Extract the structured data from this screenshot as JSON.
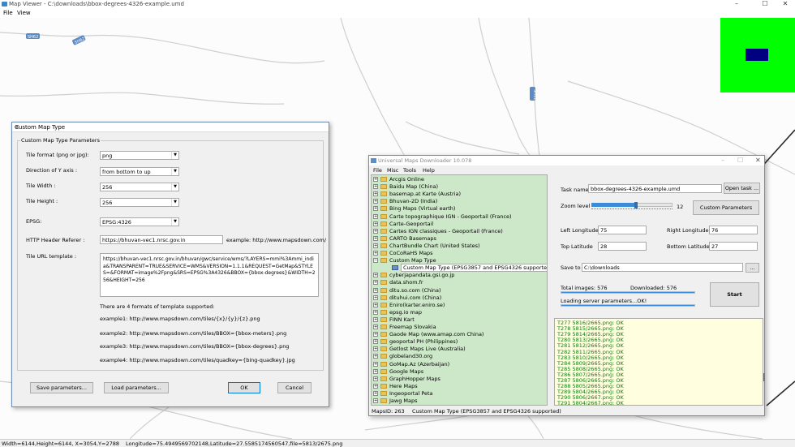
{
  "window": {
    "title": "Map Viewer - C:\\downloads\\bbox-degrees-4326-example.umd",
    "controls": [
      "–",
      "☐",
      "✕"
    ]
  },
  "menubar": {
    "items": [
      "File",
      "View"
    ]
  },
  "map": {
    "road_labels": [
      "SH62",
      "SH62",
      "SH12"
    ]
  },
  "statusbar": {
    "size": "Width=6144,Height=6144, X=3054,Y=2788",
    "coords": "Longitude=75.4949569702148,Latitude=27.5585174560547,file=5813/2675.png"
  },
  "dialog": {
    "title": "Custom Map Type",
    "close": "✕",
    "group_label": "Custom Map Type Parameters",
    "tile_format_label": "Tile format (png or jpg):",
    "tile_format_value": "png",
    "y_axis_label": "Direction of Y axis :",
    "y_axis_value": "from bottom to up",
    "tile_width_label": "Tile Width :",
    "tile_width_value": "256",
    "tile_height_label": "Tile Height :",
    "tile_height_value": "256",
    "epsg_label": "EPSG:",
    "epsg_value": "EPSG:4326",
    "referer_label": "HTTP Header Referer :",
    "referer_value": "https://bhuvan-vec1.nrsc.gov.in",
    "referer_example": "example: http://www.mapsdown.com/",
    "url_label": "Tile URL template :",
    "url_value": "https://bhuvan-vec1.nrsc.gov.in/bhuvan/gwc/service/wms/?LAYERS=mmi%3Ammi_india&TRANSPARENT=TRUE&SERVICE=WMS&VERSION=1.1.1&REQUEST=GetMap&STYLES=&FORMAT=image%2Fpng&SRS=EPSG%3A4326&BBOX={bbox-degrees}&WIDTH=256&HEIGHT=256",
    "formats_intro": "There are 4 formats of template supported:",
    "example1": "example1: http://www.mapsdown.com/tiles/{x}/{y}/{z}.png",
    "example2": "example2: http://www.mapsdown.com/tiles/BBOX={bbox-meters}.png",
    "example3": "example3: http://www.mapsdown.com/tiles/BBOX={bbox-degrees}.png",
    "example4": "example4: http://www.mapsdown.com/tiles/quadkey={bing-quadkey}.jpg",
    "save_button": "Save parameters...",
    "load_button": "Load parameters...",
    "ok_button": "OK",
    "cancel_button": "Cancel"
  },
  "umd": {
    "title": "Universal Maps Downloader 10.078",
    "menu": [
      "File",
      "Misc",
      "Tools",
      "Help"
    ],
    "tree": [
      {
        "label": "Arcgis Online",
        "selected": false,
        "child": false
      },
      {
        "label": "Baidu Map (China)",
        "selected": false,
        "child": false
      },
      {
        "label": "basemap.at Karte (Austria)",
        "selected": false,
        "child": false
      },
      {
        "label": "Bhuvan-2D (India)",
        "selected": false,
        "child": false
      },
      {
        "label": "Bing Maps (Virtual earth)",
        "selected": false,
        "child": false
      },
      {
        "label": "Carte topographique IGN - Geoportail (France)",
        "selected": false,
        "child": false
      },
      {
        "label": "Carte-Geoportail",
        "selected": false,
        "child": false
      },
      {
        "label": "Cartes IGN classiques - Geoportail (France)",
        "selected": false,
        "child": false
      },
      {
        "label": "CARTO Basemaps",
        "selected": false,
        "child": false
      },
      {
        "label": "ChartBundle Chart (United States)",
        "selected": false,
        "child": false
      },
      {
        "label": "CoCoRaHS Maps",
        "selected": false,
        "child": false
      },
      {
        "label": "Custom Map Type",
        "selected": false,
        "child": false,
        "open": true
      },
      {
        "label": "Custom Map Type (EPSG3857 and EPSG4326 supported)",
        "selected": true,
        "child": true
      },
      {
        "label": "cyberjapandata.gsi.go.jp",
        "selected": false,
        "child": false
      },
      {
        "label": "data.shom.fr",
        "selected": false,
        "child": false
      },
      {
        "label": "ditu.so.com (China)",
        "selected": false,
        "child": false
      },
      {
        "label": "dituhui.com (China)",
        "selected": false,
        "child": false
      },
      {
        "label": "Eniro(karter.eniro.se)",
        "selected": false,
        "child": false
      },
      {
        "label": "epsg.io map",
        "selected": false,
        "child": false
      },
      {
        "label": "FINN Kart",
        "selected": false,
        "child": false
      },
      {
        "label": "Freemap Slovakia",
        "selected": false,
        "child": false
      },
      {
        "label": "Gaode Map (www.amap.com China)",
        "selected": false,
        "child": false
      },
      {
        "label": "geoportal PH (Philippines)",
        "selected": false,
        "child": false
      },
      {
        "label": "Getlost Maps Live (Australia)",
        "selected": false,
        "child": false
      },
      {
        "label": "globeland30.org",
        "selected": false,
        "child": false
      },
      {
        "label": "GoMap.Az (Azerbaijan)",
        "selected": false,
        "child": false
      },
      {
        "label": "Google Maps",
        "selected": false,
        "child": false
      },
      {
        "label": "GraphHopper Maps",
        "selected": false,
        "child": false
      },
      {
        "label": "Here Maps",
        "selected": false,
        "child": false
      },
      {
        "label": "Ingeoportal Peta",
        "selected": false,
        "child": false
      },
      {
        "label": "Jawg Maps",
        "selected": false,
        "child": false
      }
    ],
    "task_name_label": "Task name",
    "task_name_value": "bbox-degrees-4326-example.umd",
    "open_task_button": "Open task ...",
    "zoom_label": "Zoom level",
    "zoom_value": "12",
    "zoom_fraction": 0.55,
    "custom_params_button": "Custom Parameters",
    "left_lon_label": "Left Longitude",
    "left_lon_value": "75",
    "right_lon_label": "Right Longitude",
    "right_lon_value": "76",
    "top_lat_label": "Top Latitude",
    "top_lat_value": "28",
    "bottom_lat_label": "Bottom Latitude",
    "bottom_lat_value": "27",
    "save_to_label": "Save to",
    "save_to_value": "C:\\downloads",
    "browse_button": "...",
    "total_images": "Total images: 576",
    "downloaded": "Downloaded: 576",
    "loading_text": "Loading server parameters...OK!",
    "start_button": "Start",
    "log": [
      "T277 5816/2665.png: OK",
      "T278 5815/2665.png: OK",
      "T279 5814/2665.png: OK",
      "T280 5813/2665.png: OK",
      "T281 5812/2665.png: OK",
      "T282 5811/2665.png: OK",
      "T283 5810/2665.png: OK",
      "T284 5809/2665.png: OK",
      "T285 5808/2665.png: OK",
      "T286 5807/2665.png: OK",
      "T287 5806/2665.png: OK",
      "T288 5805/2665.png: OK",
      "T289 5804/2665.png: OK",
      "T290 5806/2667.png: OK",
      "T291 5804/2667.png: OK"
    ],
    "status_mapsid": "MapsID: 263",
    "status_maptype": "Custom Map Type (EPSG3857 and EPSG4326 supported)"
  },
  "colors": {
    "tree_bg": "#cde8c8",
    "log_bg": "#ffffe0",
    "overview_bg": "#00ff00",
    "overview_viewport": "#000080",
    "road_color": "#c8c8c8",
    "highway_color": "#2a2a2a"
  }
}
